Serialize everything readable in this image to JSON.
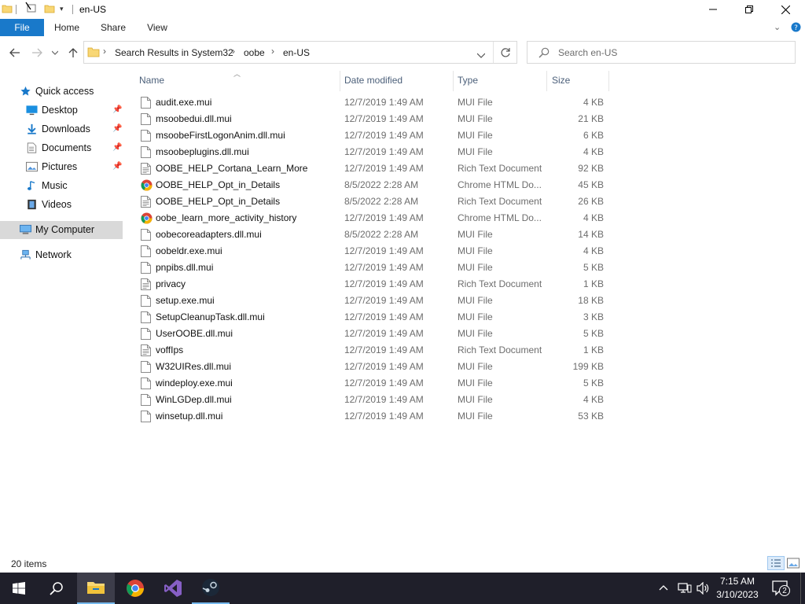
{
  "window": {
    "title": "en-US",
    "quick_access_toolbar": [
      "folder-icon",
      "properties-icon",
      "new-folder-icon",
      "customize-dropdown-icon"
    ]
  },
  "ribbon": {
    "tabs": [
      {
        "label": "File",
        "active": true
      },
      {
        "label": "Home"
      },
      {
        "label": "Share"
      },
      {
        "label": "View"
      }
    ]
  },
  "address": {
    "breadcrumb": [
      "Search Results in System32",
      "oobe",
      "en-US"
    ],
    "search_placeholder": "Search en-US"
  },
  "nav_pane": {
    "quick_access": "Quick access",
    "pinned": [
      {
        "label": "Desktop",
        "icon": "desktop-icon"
      },
      {
        "label": "Downloads",
        "icon": "downloads-icon"
      },
      {
        "label": "Documents",
        "icon": "documents-icon"
      },
      {
        "label": "Pictures",
        "icon": "pictures-icon"
      }
    ],
    "libraries": [
      {
        "label": "Music",
        "icon": "music-icon"
      },
      {
        "label": "Videos",
        "icon": "videos-icon"
      }
    ],
    "my_computer": "My Computer",
    "network": "Network"
  },
  "columns": {
    "name": "Name",
    "date": "Date modified",
    "type": "Type",
    "size": "Size"
  },
  "files": [
    {
      "name": "audit.exe.mui",
      "date": "12/7/2019 1:49 AM",
      "type": "MUI File",
      "size": "4 KB",
      "icon": "file"
    },
    {
      "name": "msoobedui.dll.mui",
      "date": "12/7/2019 1:49 AM",
      "type": "MUI File",
      "size": "21 KB",
      "icon": "file"
    },
    {
      "name": "msoobeFirstLogonAnim.dll.mui",
      "date": "12/7/2019 1:49 AM",
      "type": "MUI File",
      "size": "6 KB",
      "icon": "file"
    },
    {
      "name": "msoobeplugins.dll.mui",
      "date": "12/7/2019 1:49 AM",
      "type": "MUI File",
      "size": "4 KB",
      "icon": "file"
    },
    {
      "name": "OOBE_HELP_Cortana_Learn_More",
      "date": "12/7/2019 1:49 AM",
      "type": "Rich Text Document",
      "size": "92 KB",
      "icon": "rtf"
    },
    {
      "name": "OOBE_HELP_Opt_in_Details",
      "date": "8/5/2022 2:28 AM",
      "type": "Chrome HTML Do...",
      "size": "45 KB",
      "icon": "chrome"
    },
    {
      "name": "OOBE_HELP_Opt_in_Details",
      "date": "8/5/2022 2:28 AM",
      "type": "Rich Text Document",
      "size": "26 KB",
      "icon": "rtf"
    },
    {
      "name": "oobe_learn_more_activity_history",
      "date": "12/7/2019 1:49 AM",
      "type": "Chrome HTML Do...",
      "size": "4 KB",
      "icon": "chrome"
    },
    {
      "name": "oobecoreadapters.dll.mui",
      "date": "8/5/2022 2:28 AM",
      "type": "MUI File",
      "size": "14 KB",
      "icon": "file"
    },
    {
      "name": "oobeldr.exe.mui",
      "date": "12/7/2019 1:49 AM",
      "type": "MUI File",
      "size": "4 KB",
      "icon": "file"
    },
    {
      "name": "pnpibs.dll.mui",
      "date": "12/7/2019 1:49 AM",
      "type": "MUI File",
      "size": "5 KB",
      "icon": "file"
    },
    {
      "name": "privacy",
      "date": "12/7/2019 1:49 AM",
      "type": "Rich Text Document",
      "size": "1 KB",
      "icon": "rtf"
    },
    {
      "name": "setup.exe.mui",
      "date": "12/7/2019 1:49 AM",
      "type": "MUI File",
      "size": "18 KB",
      "icon": "file"
    },
    {
      "name": "SetupCleanupTask.dll.mui",
      "date": "12/7/2019 1:49 AM",
      "type": "MUI File",
      "size": "3 KB",
      "icon": "file"
    },
    {
      "name": "UserOOBE.dll.mui",
      "date": "12/7/2019 1:49 AM",
      "type": "MUI File",
      "size": "5 KB",
      "icon": "file"
    },
    {
      "name": "voffIps",
      "date": "12/7/2019 1:49 AM",
      "type": "Rich Text Document",
      "size": "1 KB",
      "icon": "rtf"
    },
    {
      "name": "W32UIRes.dll.mui",
      "date": "12/7/2019 1:49 AM",
      "type": "MUI File",
      "size": "199 KB",
      "icon": "file"
    },
    {
      "name": "windeploy.exe.mui",
      "date": "12/7/2019 1:49 AM",
      "type": "MUI File",
      "size": "5 KB",
      "icon": "file"
    },
    {
      "name": "WinLGDep.dll.mui",
      "date": "12/7/2019 1:49 AM",
      "type": "MUI File",
      "size": "4 KB",
      "icon": "file"
    },
    {
      "name": "winsetup.dll.mui",
      "date": "12/7/2019 1:49 AM",
      "type": "MUI File",
      "size": "53 KB",
      "icon": "file"
    }
  ],
  "status": {
    "item_count": "20 items"
  },
  "taskbar": {
    "apps": [
      "windows-start-icon",
      "search-icon",
      "file-explorer-icon",
      "chrome-icon",
      "visual-studio-icon",
      "steam-icon"
    ],
    "clock_time": "7:15 AM",
    "clock_date": "3/10/2023",
    "notification_count": "2"
  },
  "colors": {
    "accent": "#1979ca",
    "taskbar": "#1f1f2a",
    "selection": "#d9d9d9"
  }
}
